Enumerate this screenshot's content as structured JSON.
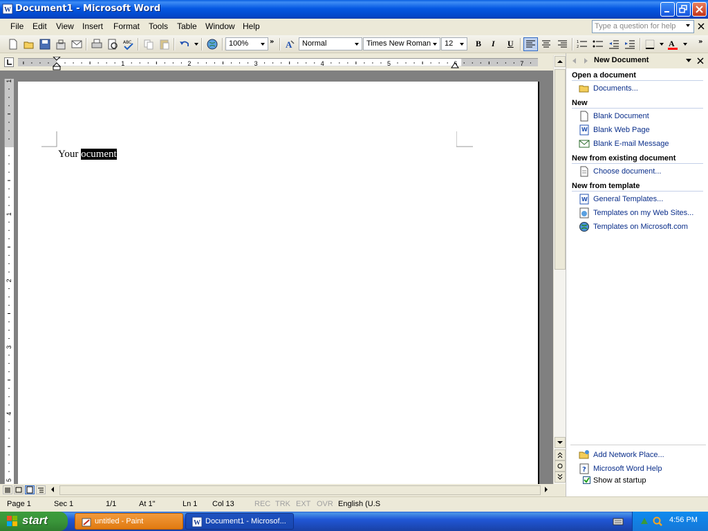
{
  "window": {
    "title": "Document1 - Microsoft Word"
  },
  "menu": {
    "items": [
      "File",
      "Edit",
      "View",
      "Insert",
      "Format",
      "Tools",
      "Table",
      "Window",
      "Help"
    ],
    "help_placeholder": "Type a question for help"
  },
  "toolbar": {
    "zoom": "100%",
    "style": "Normal",
    "font": "Times New Roman",
    "size": "12",
    "bold": "B",
    "italic": "I",
    "underline": "U",
    "font_color": "#ff0000"
  },
  "ruler": {
    "numbers": [
      "1",
      "2",
      "3",
      "4",
      "5",
      "6",
      "7"
    ],
    "vnumbers": [
      "1",
      "1",
      "2",
      "3",
      "4",
      "5"
    ]
  },
  "document": {
    "text_plain": "Your ",
    "text_selected": "ocument"
  },
  "task_pane": {
    "title": "New Document",
    "sections": [
      {
        "heading": "Open a document",
        "links": [
          {
            "label": "Documents...",
            "icon": "folder-icon"
          }
        ]
      },
      {
        "heading": "New",
        "links": [
          {
            "label": "Blank Document",
            "icon": "blank-document-icon"
          },
          {
            "label": "Blank Web Page",
            "icon": "web-page-icon"
          },
          {
            "label": "Blank E-mail Message",
            "icon": "email-icon"
          }
        ]
      },
      {
        "heading": "New from existing document",
        "links": [
          {
            "label": "Choose document...",
            "icon": "document-icon"
          }
        ]
      },
      {
        "heading": "New from template",
        "links": [
          {
            "label": "General Templates...",
            "icon": "template-icon"
          },
          {
            "label": "Templates on my Web Sites...",
            "icon": "web-template-icon"
          },
          {
            "label": "Templates on Microsoft.com",
            "icon": "globe-icon"
          }
        ]
      }
    ],
    "footer_links": [
      {
        "label": "Add Network Place...",
        "icon": "network-folder-icon"
      },
      {
        "label": "Microsoft Word Help",
        "icon": "help-icon"
      }
    ],
    "show_at_startup": "Show at startup",
    "show_at_startup_checked": true
  },
  "status": {
    "page": "Page 1",
    "sec": "Sec 1",
    "pages": "1/1",
    "at": "At 1\"",
    "ln": "Ln 1",
    "col": "Col 13",
    "rec": "REC",
    "trk": "TRK",
    "ext": "EXT",
    "ovr": "OVR",
    "language": "English (U.S"
  },
  "taskbar": {
    "start": "start",
    "tasks": [
      {
        "label": "untitled - Paint"
      },
      {
        "label": "Document1 - Microsof..."
      }
    ],
    "clock": "4:56 PM"
  }
}
